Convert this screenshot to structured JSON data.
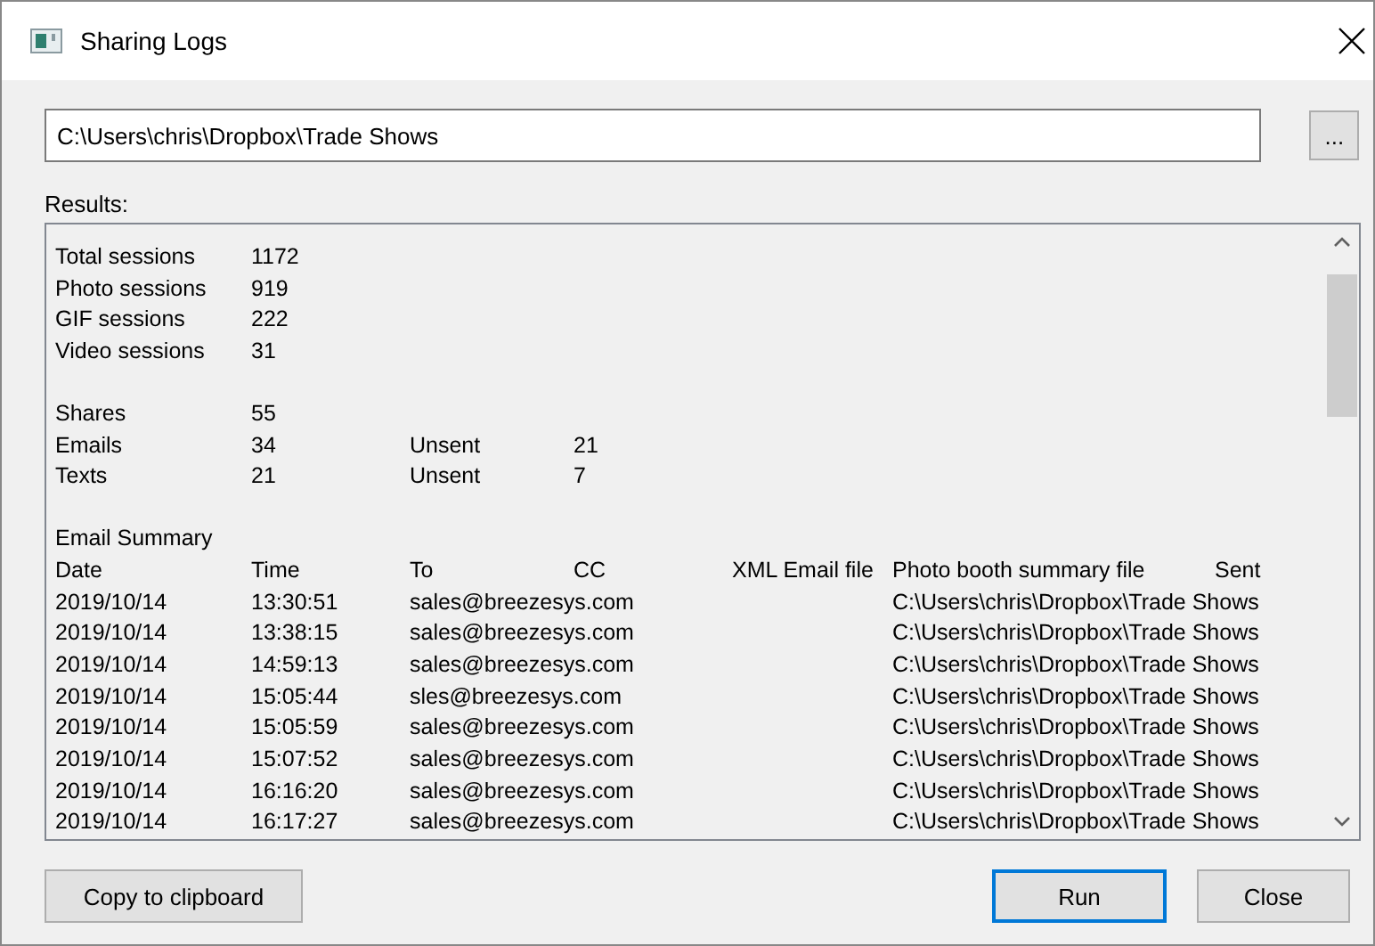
{
  "window": {
    "title": "Sharing Logs"
  },
  "folder": {
    "value": "C:\\Users\\chris\\Dropbox\\Trade Shows",
    "browse_label": "..."
  },
  "results": {
    "label": "Results:",
    "groups": [
      {
        "rows": [
          {
            "label": "Total sessions",
            "value": "1172"
          },
          {
            "label": "Photo sessions",
            "value": "919"
          },
          {
            "label": "GIF sessions",
            "value": "222"
          },
          {
            "label": "Video sessions",
            "value": "31"
          }
        ]
      },
      {
        "rows": [
          {
            "label": "Shares",
            "value": "55"
          },
          {
            "label": "Emails",
            "value": "34",
            "extra_label": "Unsent",
            "extra_value": "21"
          },
          {
            "label": "Texts",
            "value": "21",
            "extra_label": "Unsent",
            "extra_value": "7"
          }
        ]
      }
    ],
    "email_summary": {
      "title": "Email Summary",
      "columns": [
        "Date",
        "Time",
        "To",
        "CC",
        "XML Email file",
        "Photo booth summary file",
        "Sent"
      ],
      "rows": [
        {
          "date": "2019/10/14",
          "time": "13:30:51",
          "to": "sales@breezesys.com",
          "summary_file": "C:\\Users\\chris\\Dropbox\\Trade Shows"
        },
        {
          "date": "2019/10/14",
          "time": "13:38:15",
          "to": "sales@breezesys.com",
          "summary_file": "C:\\Users\\chris\\Dropbox\\Trade Shows"
        },
        {
          "date": "2019/10/14",
          "time": "14:59:13",
          "to": "sales@breezesys.com",
          "summary_file": "C:\\Users\\chris\\Dropbox\\Trade Shows"
        },
        {
          "date": "2019/10/14",
          "time": "15:05:44",
          "to": "sles@breezesys.com",
          "summary_file": "C:\\Users\\chris\\Dropbox\\Trade Shows"
        },
        {
          "date": "2019/10/14",
          "time": "15:05:59",
          "to": "sales@breezesys.com",
          "summary_file": "C:\\Users\\chris\\Dropbox\\Trade Shows"
        },
        {
          "date": "2019/10/14",
          "time": "15:07:52",
          "to": "sales@breezesys.com",
          "summary_file": "C:\\Users\\chris\\Dropbox\\Trade Shows"
        },
        {
          "date": "2019/10/14",
          "time": "16:16:20",
          "to": "sales@breezesys.com",
          "summary_file": "C:\\Users\\chris\\Dropbox\\Trade Shows"
        },
        {
          "date": "2019/10/14",
          "time": "16:17:27",
          "to": "sales@breezesys.com",
          "summary_file": "C:\\Users\\chris\\Dropbox\\Trade Shows"
        }
      ]
    }
  },
  "buttons": [
    {
      "label": "Copy to clipboard",
      "kind": "left",
      "default": false
    },
    {
      "label": "Run",
      "kind": "right",
      "default": true
    },
    {
      "label": "Close",
      "kind": "right",
      "default": false
    }
  ]
}
